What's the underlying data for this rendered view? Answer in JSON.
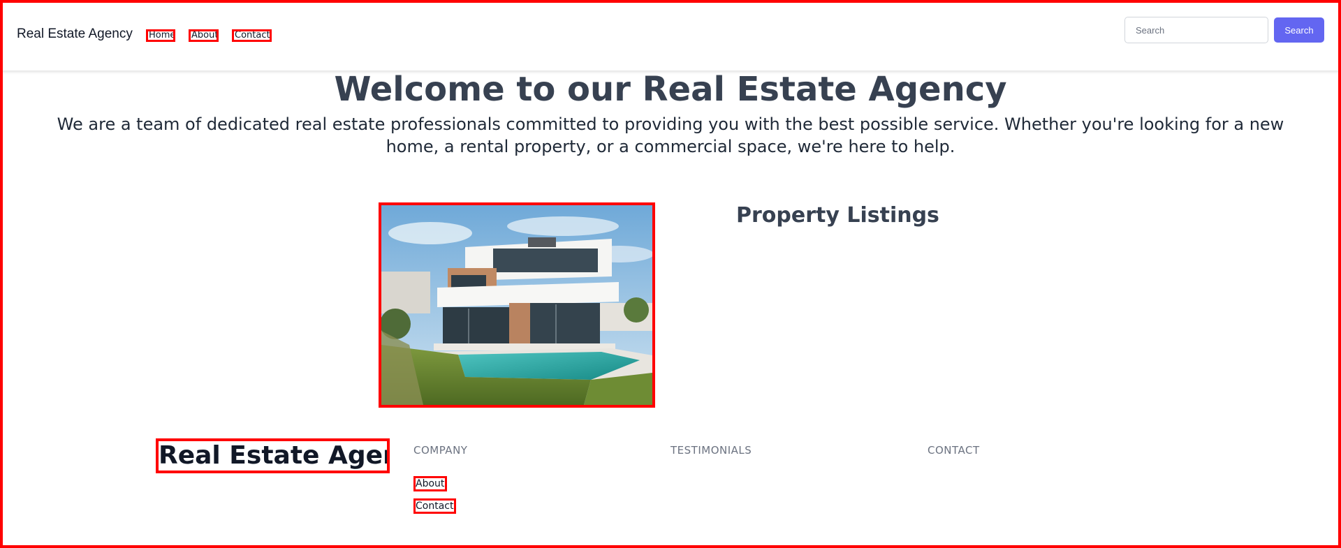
{
  "header": {
    "brand": "Real Estate Agency",
    "nav": {
      "home": "Home",
      "about": "About",
      "contact": "Contact"
    },
    "search": {
      "placeholder": "Search",
      "button_label": "Search"
    }
  },
  "hero": {
    "title": "Welcome to our Real Estate Agency",
    "text": "We are a team of dedicated real estate professionals committed to providing you with the best possible service. Whether you're looking for a new home, a rental property, or a commercial space, we're here to help."
  },
  "listings": {
    "title": "Property Listings"
  },
  "footer": {
    "brand": "Real Estate Agency",
    "columns": {
      "company": "COMPANY",
      "testimonials": "TESTIMONIALS",
      "contact": "CONTACT"
    },
    "links": {
      "about": "About",
      "contact": "Contact"
    }
  },
  "colors": {
    "accent": "#6366f1",
    "highlight_border": "#ff0000",
    "heading": "#374151",
    "muted": "#6b7280"
  }
}
